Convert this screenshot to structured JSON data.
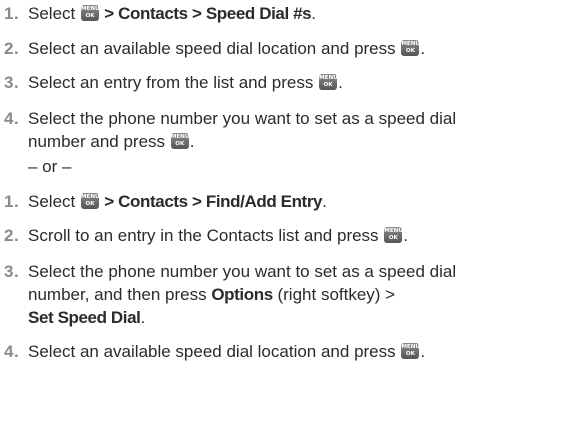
{
  "menu_icon": {
    "top": "MENU",
    "bottom": "OK"
  },
  "section_a": {
    "steps": [
      {
        "num": "1.",
        "t1": "Select ",
        "t2": " > Contacts > Speed Dial #s",
        "t3": "."
      },
      {
        "num": "2.",
        "t1": "Select an available speed dial location and press ",
        "t2": "."
      },
      {
        "num": "3.",
        "t1": "Select an entry from the list and press ",
        "t2": "."
      },
      {
        "num": "4.",
        "l1": "Select the phone number you want to set as a speed dial",
        "l2a": "number and press ",
        "l2b": "."
      }
    ]
  },
  "or_text": "– or –",
  "section_b": {
    "steps": [
      {
        "num": "1.",
        "t1": "Select ",
        "t2": " > Contacts > Find/Add Entry",
        "t3": "."
      },
      {
        "num": "2.",
        "t1": "Scroll to an entry in the Contacts list and press ",
        "t2": "."
      },
      {
        "num": "3.",
        "l1": "Select the phone number you want to set as a speed dial",
        "l2a": "number, and then press ",
        "l2b": "Options",
        "l2c": " (right softkey) >",
        "l3": "Set Speed Dial",
        "l3b": "."
      },
      {
        "num": "4.",
        "t1": "Select an available speed dial location and press ",
        "t2": "."
      }
    ]
  }
}
